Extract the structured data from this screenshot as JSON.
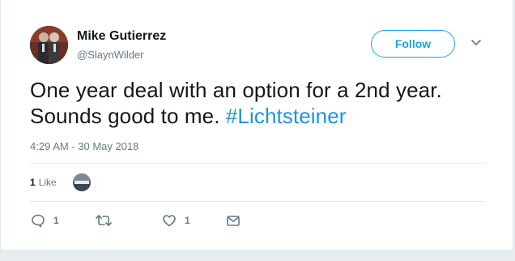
{
  "tweet": {
    "author": {
      "name": "Mike Gutierrez",
      "handle": "@SlaynWilder",
      "avatar_icon": "user-avatar"
    },
    "follow_label": "Follow",
    "text_plain": "One year deal with an option for a 2nd year. Sounds good to me. ",
    "hashtag": "#Lichtsteiner",
    "timestamp": "4:29 AM - 30 May 2018",
    "stats": {
      "likes_count": "1",
      "likes_label": "Like"
    },
    "actions": {
      "reply_count": "1",
      "like_count": "1"
    },
    "colors": {
      "accent": "#1da1f2",
      "hashtag": "#1b95e0",
      "muted": "#657786",
      "text": "#14171a",
      "divider": "#e6ecf0"
    },
    "icons": {
      "reply": "reply-icon",
      "retweet": "retweet-icon",
      "like": "heart-icon",
      "message": "envelope-icon",
      "menu": "chevron-down-icon"
    }
  }
}
